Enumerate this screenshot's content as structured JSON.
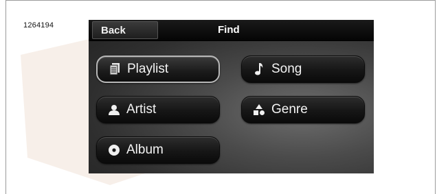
{
  "figure_code": "1264194",
  "header": {
    "back_label": "Back",
    "title": "Find"
  },
  "options": {
    "playlist": {
      "label": "Playlist",
      "icon": "playlist-icon",
      "selected": true
    },
    "song": {
      "label": "Song",
      "icon": "music-note-icon",
      "selected": false
    },
    "artist": {
      "label": "Artist",
      "icon": "person-icon",
      "selected": false
    },
    "genre": {
      "label": "Genre",
      "icon": "genre-icon",
      "selected": false
    },
    "album": {
      "label": "Album",
      "icon": "disc-icon",
      "selected": false
    }
  },
  "colors": {
    "screen_bg": "#3a3a3a",
    "button_text": "#f4f4f4",
    "selected_border": "#b8b8b8"
  }
}
